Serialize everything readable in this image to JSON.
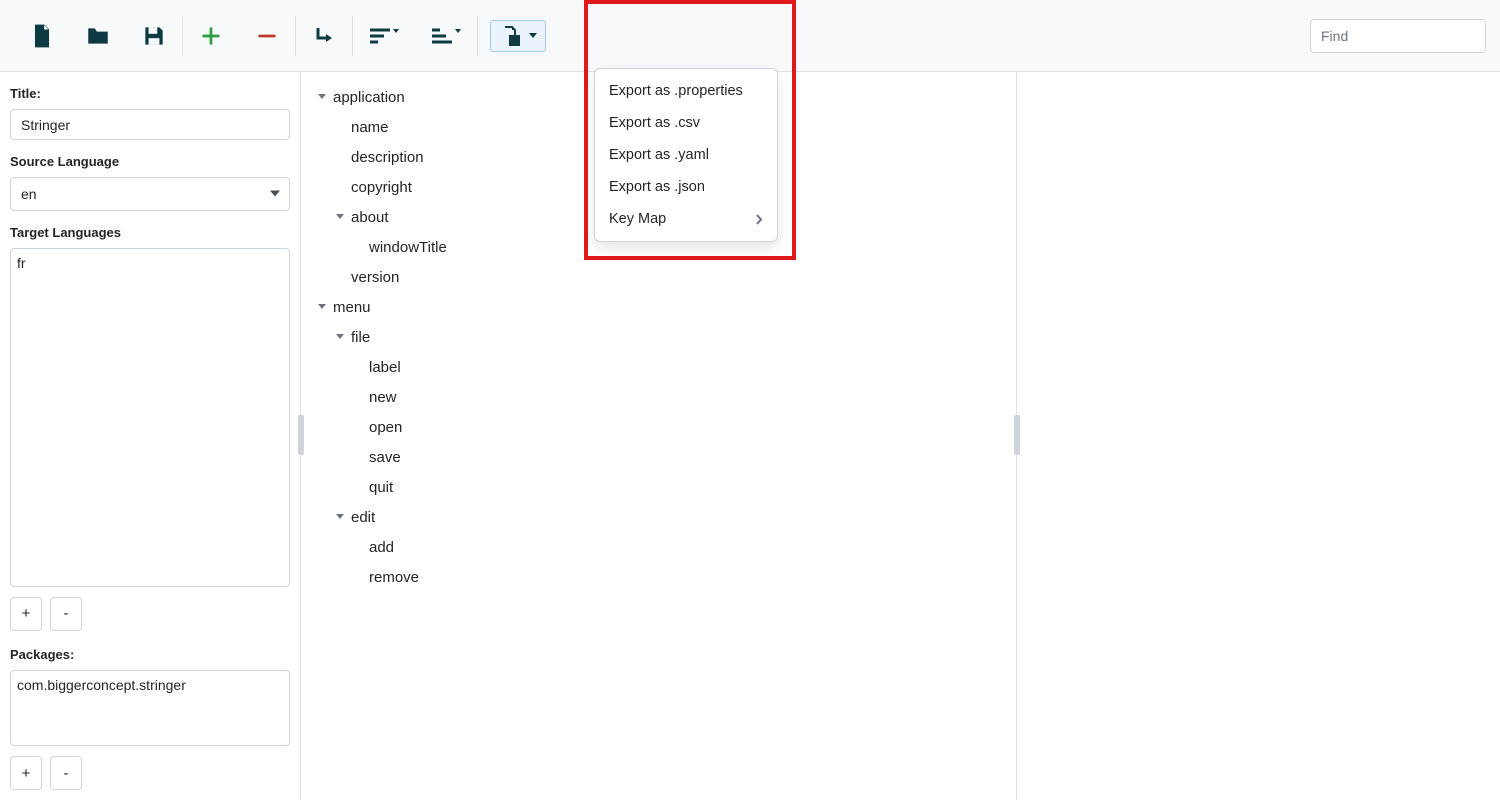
{
  "toolbar": {
    "find_placeholder": "Find"
  },
  "sidebar": {
    "title_label": "Title:",
    "title_value": "Stringer",
    "source_lang_label": "Source Language",
    "source_lang_value": "en",
    "target_lang_label": "Target Languages",
    "target_langs": [
      "fr"
    ],
    "add_btn": "+",
    "remove_btn": "-",
    "packages_label": "Packages:",
    "packages": [
      "com.biggerconcept.stringer"
    ]
  },
  "tree": [
    {
      "depth": 0,
      "caret": true,
      "label": "application"
    },
    {
      "depth": 1,
      "caret": false,
      "label": "name"
    },
    {
      "depth": 1,
      "caret": false,
      "label": "description"
    },
    {
      "depth": 1,
      "caret": false,
      "label": "copyright"
    },
    {
      "depth": 1,
      "caret": true,
      "label": "about"
    },
    {
      "depth": 2,
      "caret": false,
      "label": "windowTitle"
    },
    {
      "depth": 1,
      "caret": false,
      "label": "version"
    },
    {
      "depth": 0,
      "caret": true,
      "label": "menu"
    },
    {
      "depth": 1,
      "caret": true,
      "label": "file"
    },
    {
      "depth": 2,
      "caret": false,
      "label": "label"
    },
    {
      "depth": 2,
      "caret": false,
      "label": "new"
    },
    {
      "depth": 2,
      "caret": false,
      "label": "open"
    },
    {
      "depth": 2,
      "caret": false,
      "label": "save"
    },
    {
      "depth": 2,
      "caret": false,
      "label": "quit"
    },
    {
      "depth": 1,
      "caret": true,
      "label": "edit"
    },
    {
      "depth": 2,
      "caret": false,
      "label": "add"
    },
    {
      "depth": 2,
      "caret": false,
      "label": "remove"
    }
  ],
  "dropdown": {
    "items": [
      {
        "label": "Export as .properties"
      },
      {
        "label": "Export as .csv"
      },
      {
        "label": "Export as .yaml"
      },
      {
        "label": "Export as .json"
      },
      {
        "label": "Key Map",
        "submenu": true
      }
    ]
  }
}
